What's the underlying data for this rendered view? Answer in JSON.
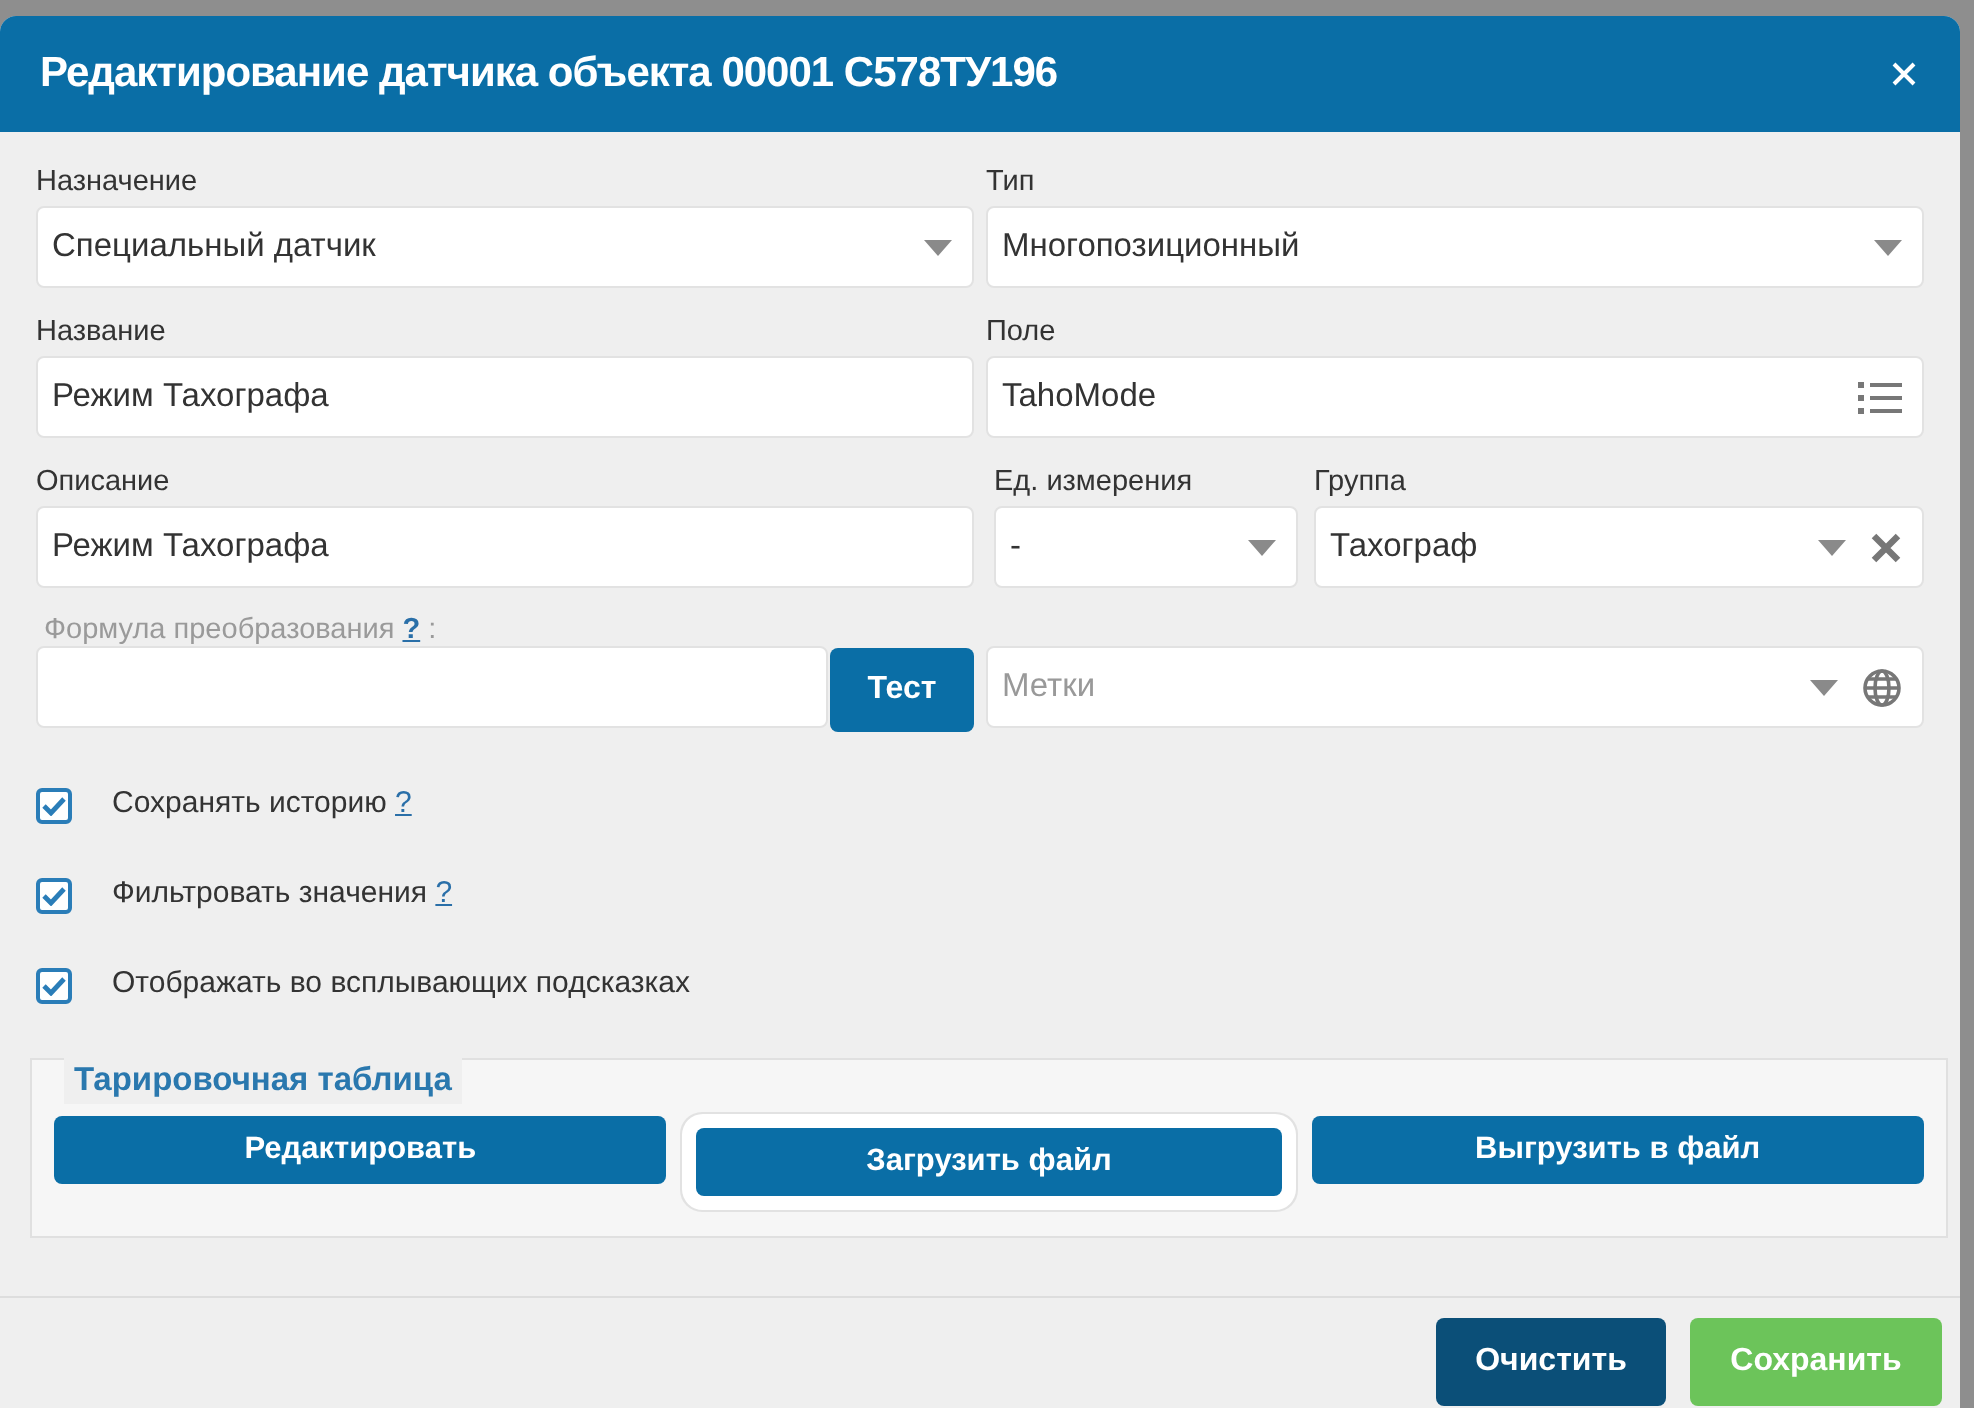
{
  "dialog": {
    "title": "Редактирование датчика объекта 00001 С578ТУ196"
  },
  "fields": [
    {
      "kind": "select",
      "label": "Назначение",
      "value": "Специальный датчик"
    },
    {
      "kind": "select",
      "label": "Тип",
      "value": "Многопозиционный"
    },
    {
      "kind": "text",
      "label": "Название",
      "value": "Режим Тахографа"
    },
    {
      "kind": "picker",
      "label": "Поле",
      "value": "TahoMode"
    },
    {
      "kind": "text",
      "label": "Описание",
      "value": "Режим Тахографа"
    },
    {
      "kind": "select",
      "label": "Ед. измерения",
      "value": "-"
    },
    {
      "kind": "clearable",
      "label": "Группа",
      "value": "Тахограф"
    }
  ],
  "formula": {
    "label": "Формула преобразования",
    "help": "?",
    "suffix": ":",
    "button": "Тест"
  },
  "tags": {
    "placeholder": "Метки"
  },
  "options": [
    {
      "label": "Сохранять историю",
      "help": "?",
      "checked": true
    },
    {
      "label": "Фильтровать значения",
      "help": "?",
      "checked": true
    },
    {
      "label": "Отображать во всплывающих подсказках",
      "checked": true
    }
  ],
  "calibration": {
    "title": "Тарировочная таблица",
    "buttons": [
      {
        "label": "Редактировать",
        "framed": false
      },
      {
        "label": "Загрузить файл",
        "framed": true
      },
      {
        "label": "Выгрузить в файл",
        "framed": false
      }
    ]
  },
  "footer_buttons": [
    {
      "label": "Очистить",
      "kind": "secondary"
    },
    {
      "label": "Сохранить",
      "kind": "primary"
    }
  ]
}
